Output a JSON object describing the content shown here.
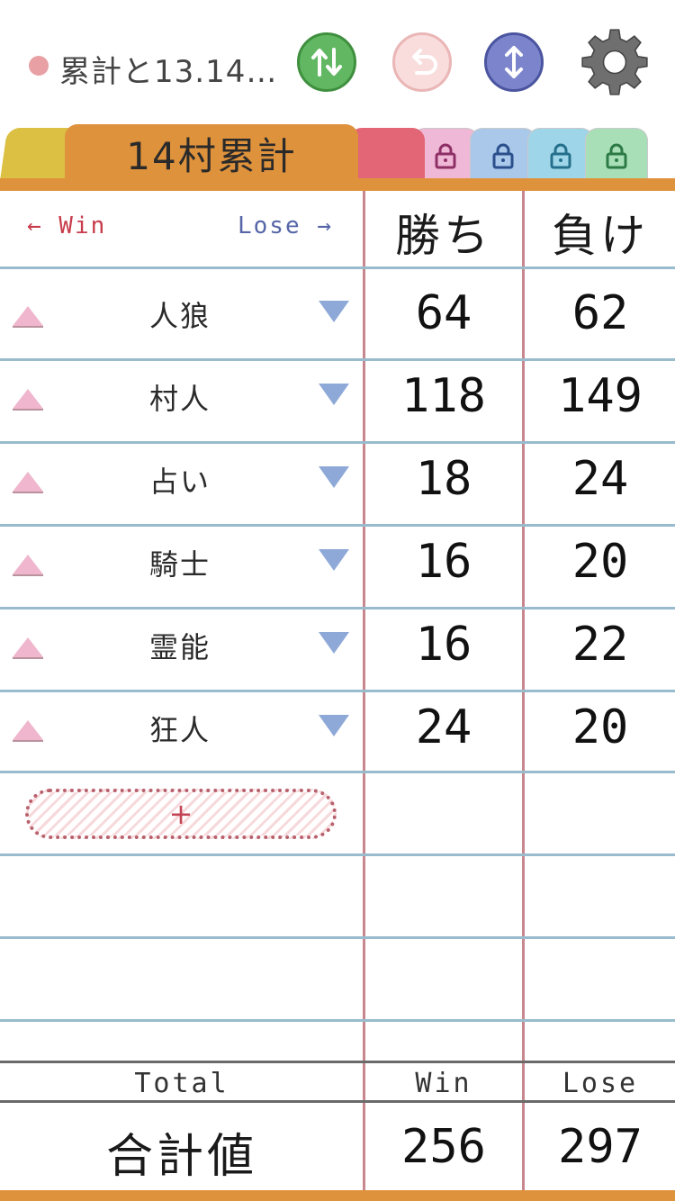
{
  "header": {
    "title": "累計と13.14…",
    "status_color": "#e8a0a4"
  },
  "toolbar": {
    "swap_icon": "swap-vertical-arrows",
    "undo_icon": "undo-arrow",
    "updown_icon": "up-down-arrow",
    "settings_icon": "gear"
  },
  "tabs": {
    "active_label": "14村累計",
    "locked_tabs": [
      "lock-pink",
      "lock-blue",
      "lock-cyan",
      "lock-green"
    ]
  },
  "table": {
    "win_hint": "← Win",
    "lose_hint": "Lose →",
    "col_win": "勝ち",
    "col_lose": "負け",
    "rows": [
      {
        "role": "人狼",
        "win": "64",
        "lose": "62"
      },
      {
        "role": "村人",
        "win": "118",
        "lose": "149"
      },
      {
        "role": "占い",
        "win": "18",
        "lose": "24"
      },
      {
        "role": "騎士",
        "win": "16",
        "lose": "20"
      },
      {
        "role": "霊能",
        "win": "16",
        "lose": "22"
      },
      {
        "role": "狂人",
        "win": "24",
        "lose": "20"
      }
    ],
    "add_label": "+"
  },
  "totals": {
    "total_label": "Total",
    "win_label": "Win",
    "lose_label": "Lose",
    "sum_label": "合計値",
    "win_total": "256",
    "lose_total": "297"
  },
  "colors": {
    "accent_orange": "#df923c",
    "line_blue": "#98bccd",
    "line_red": "#c8878e",
    "win_red": "#c83c4c",
    "lose_blue": "#5666a8"
  }
}
